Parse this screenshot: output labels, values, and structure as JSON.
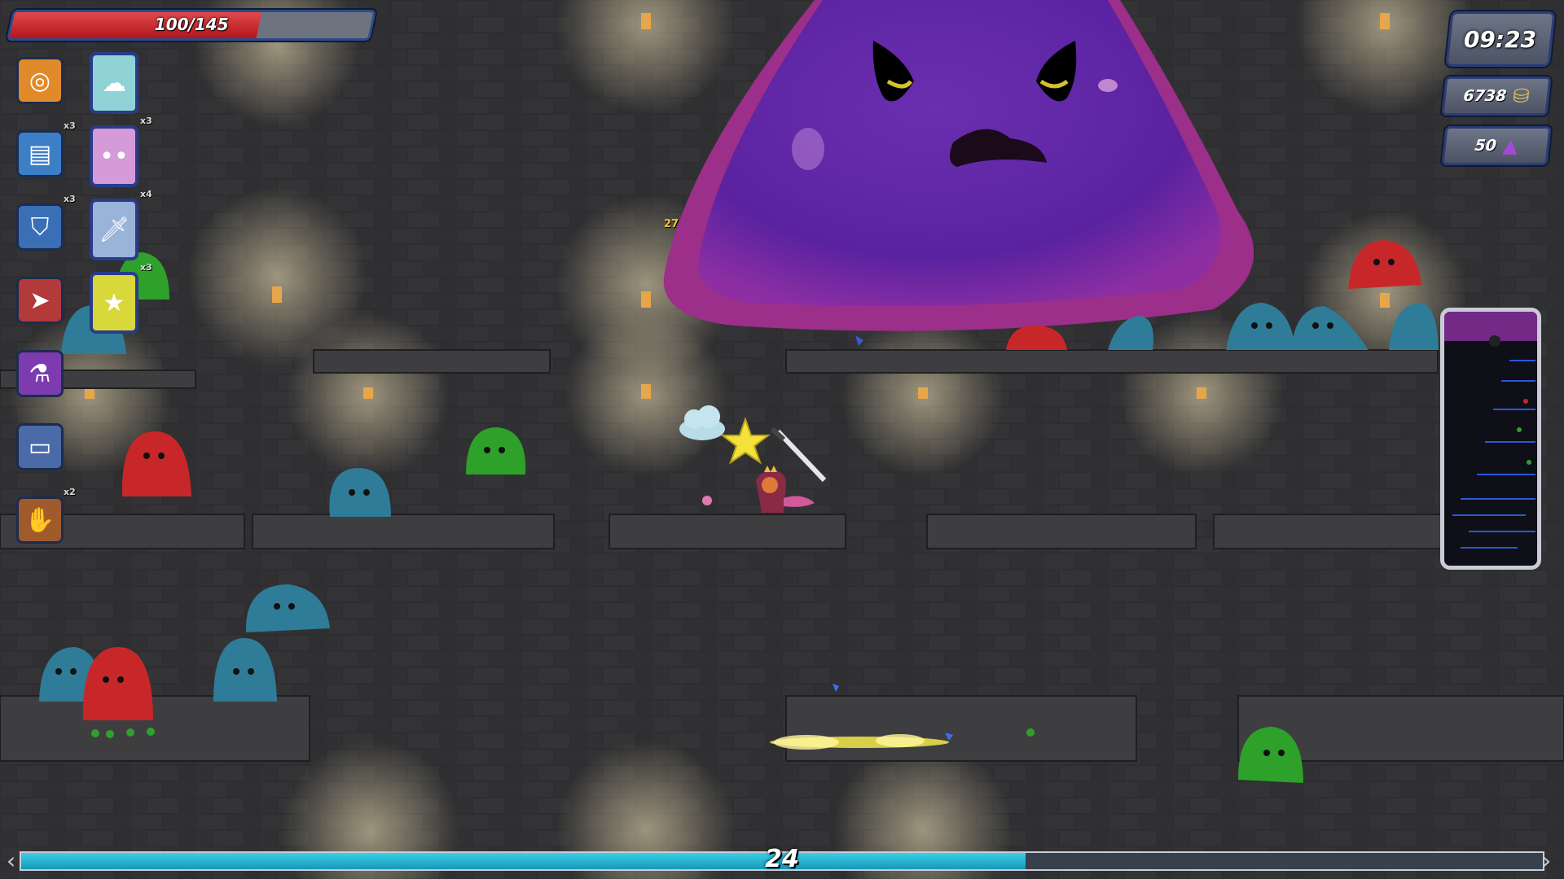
{
  "hud": {
    "health": {
      "text": "100/145",
      "current": 100,
      "max": 145
    },
    "timer": "09:23",
    "gold": {
      "value": "6738",
      "icon": "gold-coins-icon"
    },
    "gems": {
      "value": "50",
      "icon": "purple-gem-icon"
    },
    "level": {
      "value": "24",
      "progress_percent": 66
    },
    "damage_popup": "27"
  },
  "passives": [
    {
      "name": "target-icon",
      "glyph": "◎",
      "color": "#e08a2a",
      "count": ""
    },
    {
      "name": "spellbook-icon",
      "glyph": "▤",
      "color": "#3d7fc7",
      "count": "x3"
    },
    {
      "name": "armor-icon",
      "glyph": "⛉",
      "color": "#3a6fb5",
      "count": "x3"
    },
    {
      "name": "arrow-icon",
      "glyph": "➤",
      "color": "#b23a3a",
      "count": ""
    },
    {
      "name": "potion-icon",
      "glyph": "⚗",
      "color": "#7d3bb0",
      "count": ""
    },
    {
      "name": "tome-icon",
      "glyph": "▭",
      "color": "#4a6aa8",
      "count": ""
    },
    {
      "name": "glove-icon",
      "glyph": "✋",
      "color": "#a05a2c",
      "count": "x2"
    }
  ],
  "weapons": [
    {
      "name": "cloud-icon",
      "glyph": "☁",
      "color": "#8fd3d6",
      "count": ""
    },
    {
      "name": "pink-slime-icon",
      "glyph": "••",
      "color": "#d59ad8",
      "count": "x3"
    },
    {
      "name": "dagger-icon",
      "glyph": "🗡",
      "color": "#9ab3d8",
      "count": "x4"
    },
    {
      "name": "star-icon",
      "glyph": "★",
      "color": "#d9d83a",
      "count": "x3"
    }
  ]
}
